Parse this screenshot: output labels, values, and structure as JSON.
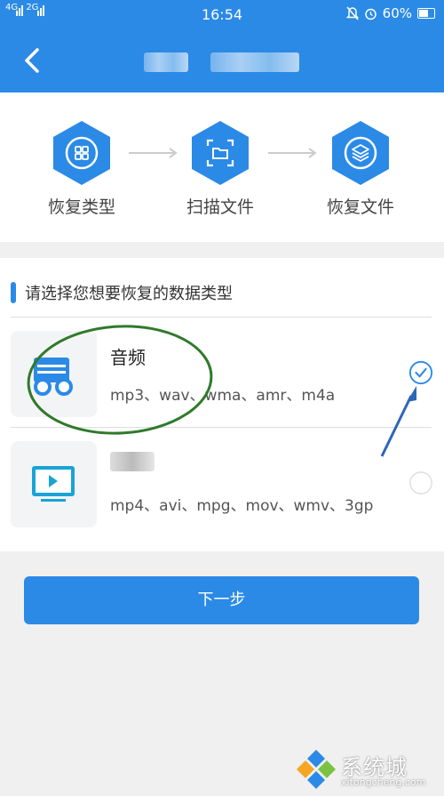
{
  "status_bar": {
    "network_1": "4G",
    "network_2": "2G",
    "time": "16:54",
    "battery": "60%"
  },
  "steps": [
    {
      "label": "恢复类型",
      "icon": "grid-icon"
    },
    {
      "label": "扫描文件",
      "icon": "scan-folder-icon"
    },
    {
      "label": "恢复文件",
      "icon": "layers-icon"
    }
  ],
  "prompt": "请选择您想要恢复的数据类型",
  "options": [
    {
      "title": "音频",
      "formats": "mp3、wav、wma、amr、m4a",
      "selected": true,
      "icon": "audio-icon"
    },
    {
      "title": "",
      "formats": "mp4、avi、mpg、mov、wmv、3gp",
      "selected": false,
      "icon": "video-icon"
    }
  ],
  "next_button": "下一步",
  "watermark": {
    "text": "系统城",
    "url": "xitongcheng.com"
  },
  "colors": {
    "primary": "#2b8ae6",
    "annotation_green": "#2f7a2a",
    "annotation_arrow": "#2d66b8"
  }
}
